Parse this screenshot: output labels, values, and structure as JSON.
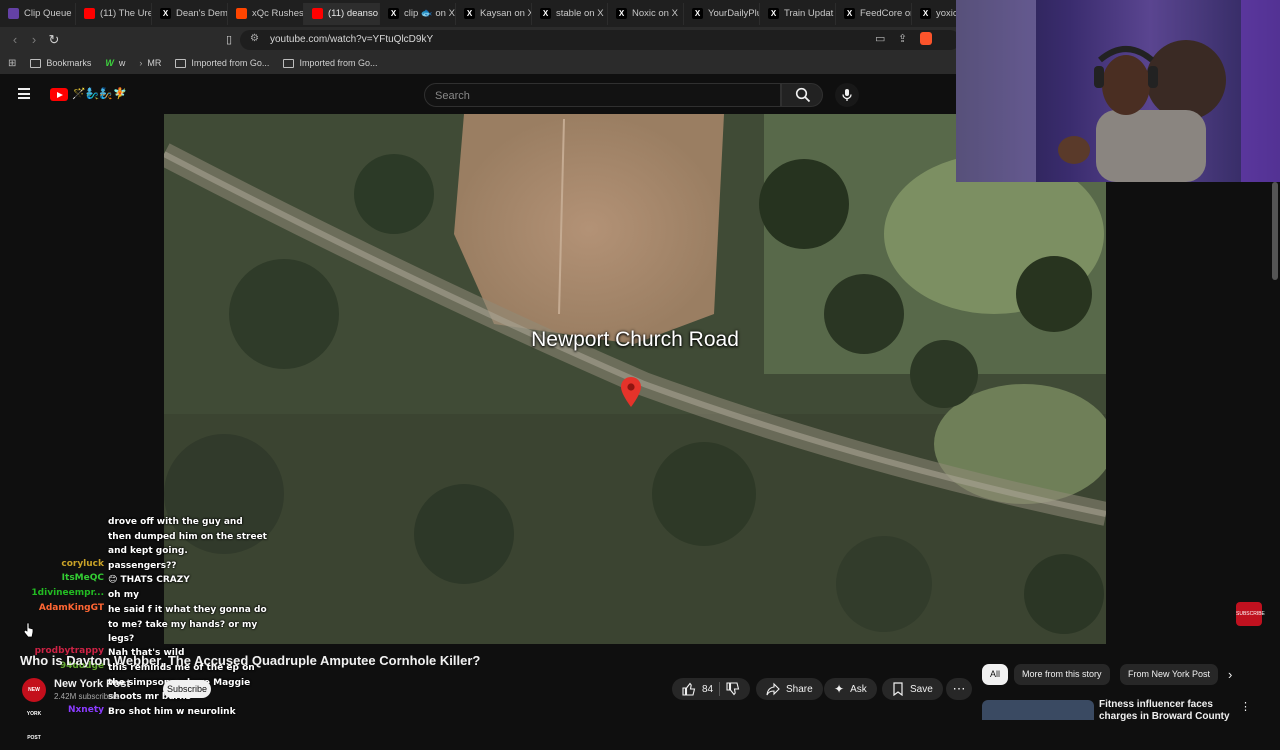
{
  "browser": {
    "tabs": [
      {
        "title": "Clip Queue",
        "icon": "twitch-icon",
        "color": "#6441a5"
      },
      {
        "title": "(11) The Ure",
        "icon": "youtube-icon",
        "color": "#ff0000"
      },
      {
        "title": "Dean's Dem",
        "icon": "x-icon",
        "color": "#000000"
      },
      {
        "title": "xQc Rushes",
        "icon": "reddit-icon",
        "color": "#ff4500"
      },
      {
        "title": "(11) deanso",
        "icon": "youtube-icon",
        "color": "#ff0000"
      },
      {
        "title": "clip 🐟 on X",
        "icon": "x-icon",
        "color": "#000000"
      },
      {
        "title": "Kaysan on X",
        "icon": "x-icon",
        "color": "#000000"
      },
      {
        "title": "stable on X",
        "icon": "x-icon",
        "color": "#000000"
      },
      {
        "title": "Noxic on X",
        "icon": "x-icon",
        "color": "#000000"
      },
      {
        "title": "YourDailyPlu",
        "icon": "x-icon",
        "color": "#000000"
      },
      {
        "title": "Train Updat",
        "icon": "x-icon",
        "color": "#000000"
      },
      {
        "title": "FeedCore or",
        "icon": "x-icon",
        "color": "#000000"
      },
      {
        "title": "yoxic",
        "icon": "x-icon",
        "color": "#000000"
      }
    ],
    "url": "youtube.com/watch?v=YFtuQlcD9kY",
    "bookmarks": [
      {
        "label": "Bookmarks",
        "icon": "folder-icon"
      },
      {
        "label": "w",
        "icon": "w-icon"
      },
      {
        "label": "MR",
        "icon": "mr-icon"
      },
      {
        "label": "Imported from Go...",
        "icon": "folder-icon"
      },
      {
        "label": "Imported from Go...",
        "icon": "folder-icon"
      }
    ]
  },
  "youtube": {
    "search_placeholder": "Search",
    "logo_emojis": "🪄🧞‍♂️🧞🧚",
    "video_overlay_text": "Newport Church Road",
    "video_title": "Who is Dayton Webber, The Accused Quadruple Amputee Cornhole Killer?",
    "channel": {
      "name": "New York Post",
      "subscribers": "2.42M subscribers",
      "avatar_text": "NEW YORK POST"
    },
    "subscribe_label": "Subscribe",
    "actions": {
      "likes": "84",
      "share": "Share",
      "ask": "Ask",
      "save": "Save"
    },
    "chips": [
      "All",
      "More from this story",
      "From New York Post"
    ],
    "recommendation_title": "Fitness influencer faces charges in Broward County",
    "sticker_text": "SUBSCRIBE"
  },
  "chat": [
    {
      "name": "",
      "message": "drove off with the guy and then dumped him on the street and kept going.",
      "color": "#ffffff"
    },
    {
      "name": "coryluck",
      "message": "passengers??",
      "color": "#c9a227"
    },
    {
      "name": "ItsMeQC",
      "message": "😊 THATS CRAZY",
      "color": "#33cc33"
    },
    {
      "name": "1divineempr...",
      "message": "oh my",
      "color": "#22bb22"
    },
    {
      "name": "AdamKingGT",
      "message": "he said f it what they gonna do to me? take my hands? or my legs?",
      "color": "#ff6633"
    },
    {
      "name": "prodbytrappy",
      "message": "Nah that's wild",
      "color": "#cc2244"
    },
    {
      "name": "94dodge",
      "message": "this reminds me of the ep on the simpsons where Maggie shoots mr burns",
      "color": "#66aa33"
    },
    {
      "name": "Nxnety",
      "message": "Bro shot him w neurolink",
      "color": "#8a3bff"
    }
  ]
}
